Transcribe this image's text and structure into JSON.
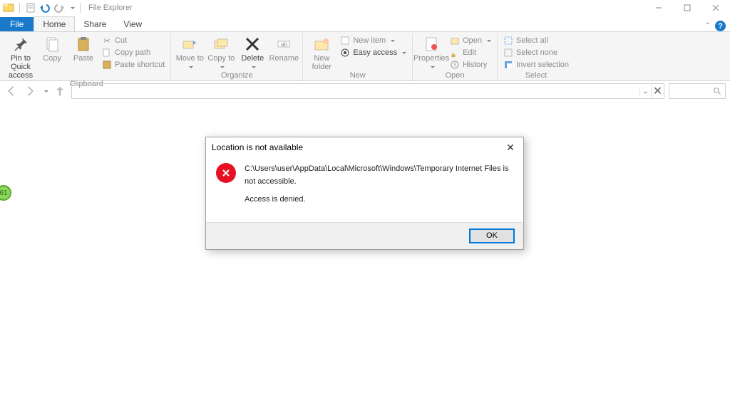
{
  "titlebar": {
    "app_title": "File Explorer"
  },
  "window_controls": {
    "minimize": "–",
    "maximize": "❐",
    "close": "✕"
  },
  "tabs": {
    "file": "File",
    "home": "Home",
    "share": "Share",
    "view": "View"
  },
  "ribbon": {
    "clipboard": {
      "label": "Clipboard",
      "pin": "Pin to Quick access",
      "copy": "Copy",
      "paste": "Paste",
      "cut": "Cut",
      "copy_path": "Copy path",
      "paste_shortcut": "Paste shortcut"
    },
    "organize": {
      "label": "Organize",
      "move_to": "Move to",
      "copy_to": "Copy to",
      "delete": "Delete",
      "rename": "Rename"
    },
    "new": {
      "label": "New",
      "new_folder": "New folder",
      "new_item": "New item",
      "easy_access": "Easy access"
    },
    "open": {
      "label": "Open",
      "properties": "Properties",
      "open": "Open",
      "edit": "Edit",
      "history": "History"
    },
    "select": {
      "label": "Select",
      "select_all": "Select all",
      "select_none": "Select none",
      "invert": "Invert selection"
    }
  },
  "nav": {
    "address": "",
    "search_placeholder": ""
  },
  "edge_badge": "61",
  "dialog": {
    "title": "Location is not available",
    "line1": "C:\\Users\\user\\AppData\\Local\\Microsoft\\Windows\\Temporary Internet Files is not accessible.",
    "line2": "Access is denied.",
    "ok": "OK"
  }
}
